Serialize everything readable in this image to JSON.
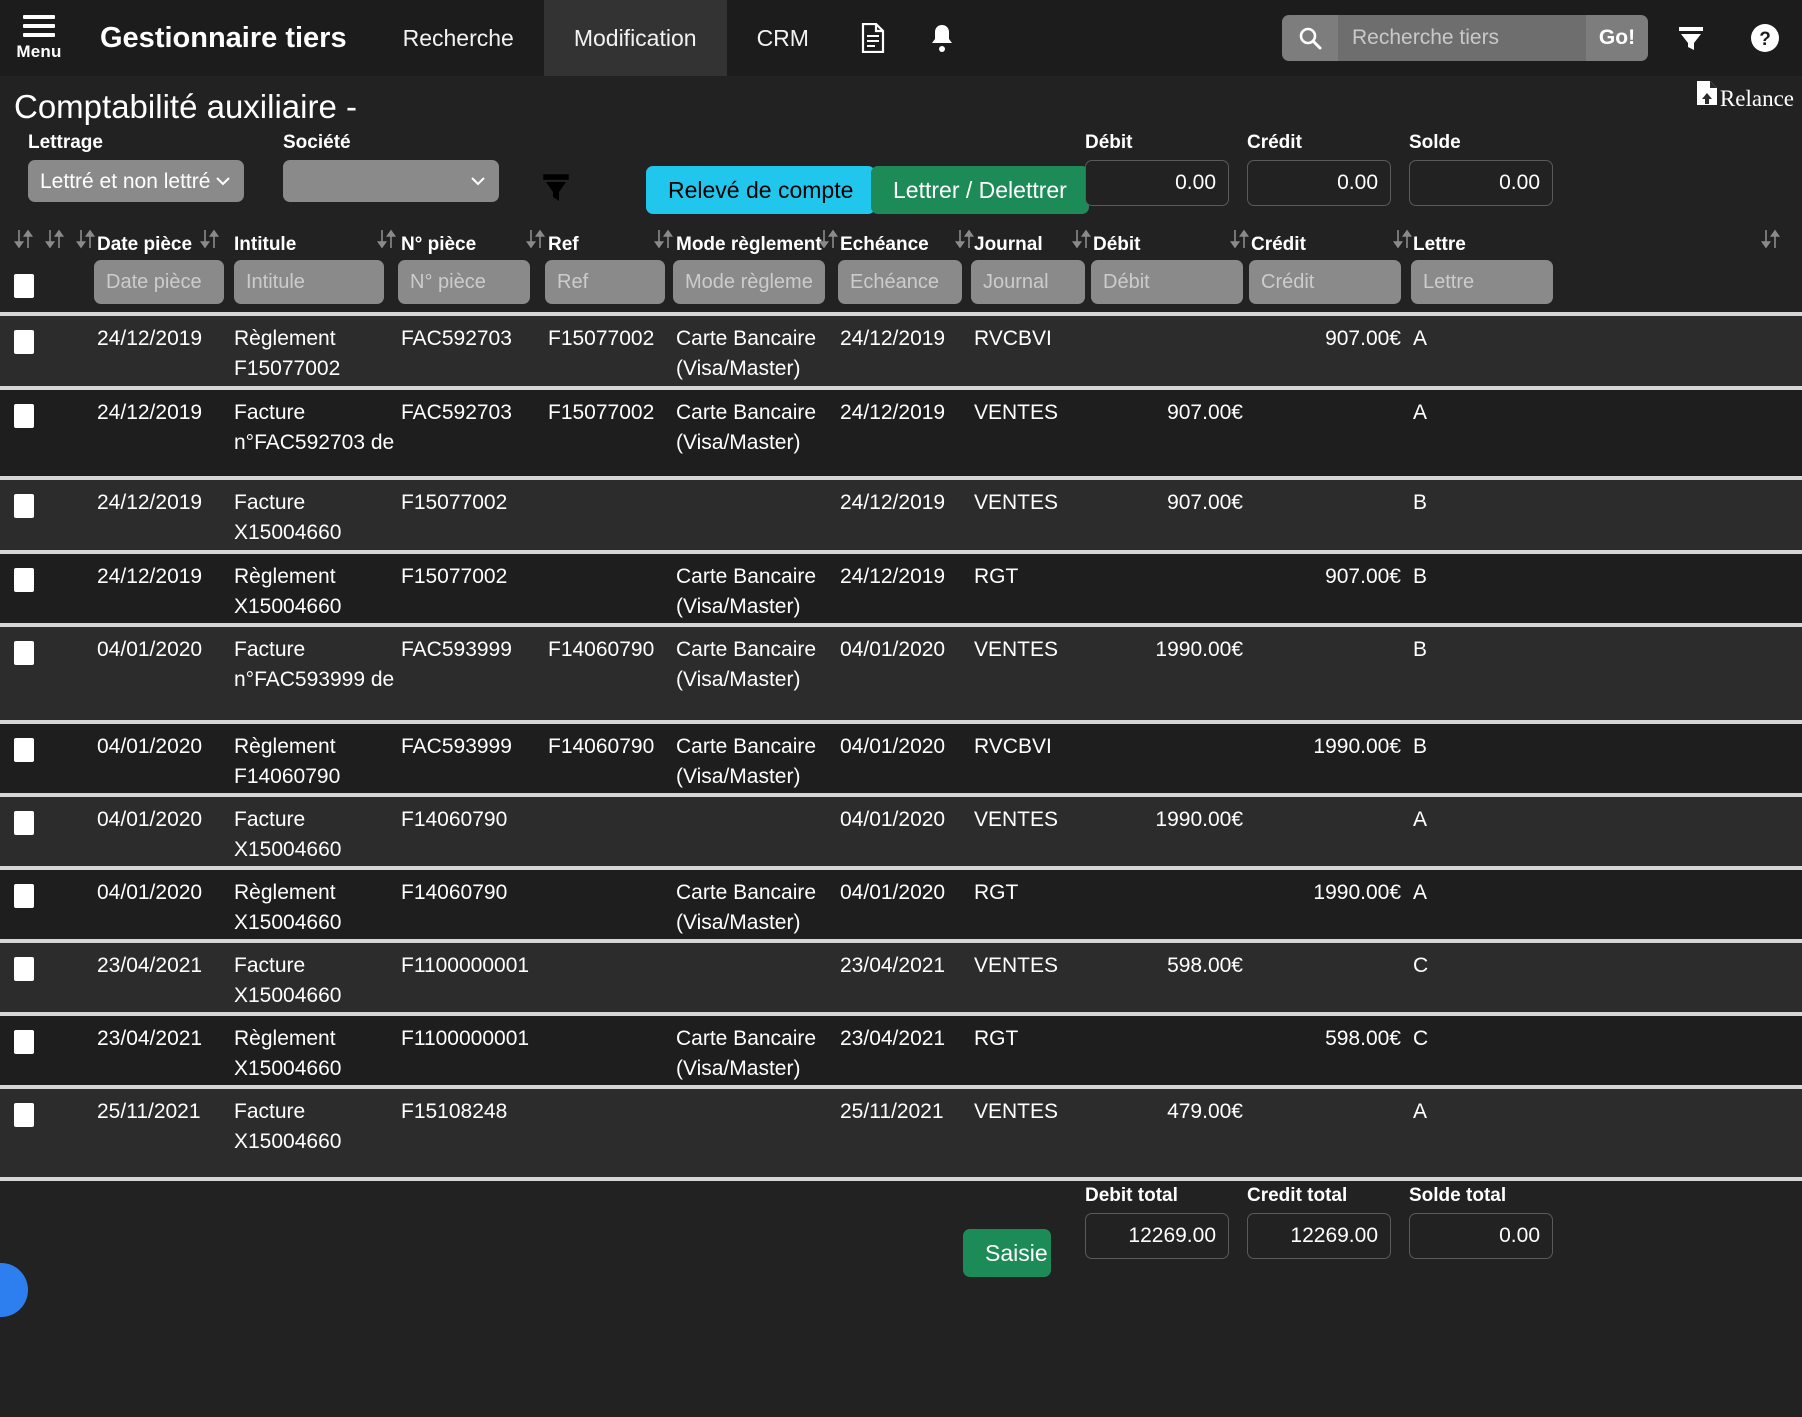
{
  "header": {
    "menu_label": "Menu",
    "app_title": "Gestionnaire tiers",
    "nav": [
      {
        "label": "Recherche",
        "active": false
      },
      {
        "label": "Modification",
        "active": true
      },
      {
        "label": "CRM",
        "active": false
      }
    ],
    "icons": [
      "document-icon",
      "bell-icon"
    ],
    "search": {
      "placeholder": "Recherche tiers",
      "value": "",
      "go_label": "Go!"
    },
    "tools": [
      "filter-icon",
      "help-icon"
    ]
  },
  "page": {
    "title": "Comptabilité auxiliaire -",
    "relance_label": "Relance"
  },
  "filters": {
    "lettrage": {
      "label": "Lettrage",
      "value": "Lettré et non lettré"
    },
    "societe": {
      "label": "Société",
      "value": ""
    },
    "funnel_icon": "funnel-icon",
    "releve_button": "Relevé de compte",
    "lettrer_button": "Lettrer / Delettrer",
    "debit": {
      "label": "Débit",
      "value": "0.00"
    },
    "credit": {
      "label": "Crédit",
      "value": "0.00"
    },
    "solde": {
      "label": "Solde",
      "value": "0.00"
    }
  },
  "table": {
    "columns": [
      {
        "key": "date",
        "label": "Date pièce",
        "placeholder": "Date pièce"
      },
      {
        "key": "intitule",
        "label": "Intitule",
        "placeholder": "Intitule"
      },
      {
        "key": "npiece",
        "label": "N° pièce",
        "placeholder": "N° pièce"
      },
      {
        "key": "ref",
        "label": "Ref",
        "placeholder": "Ref"
      },
      {
        "key": "mode",
        "label": "Mode règlement",
        "placeholder": "Mode règlement"
      },
      {
        "key": "echeance",
        "label": "Echéance",
        "placeholder": "Echéance"
      },
      {
        "key": "journal",
        "label": "Journal",
        "placeholder": "Journal"
      },
      {
        "key": "debit",
        "label": "Débit",
        "placeholder": "Débit"
      },
      {
        "key": "credit",
        "label": "Crédit",
        "placeholder": "Crédit"
      },
      {
        "key": "lettre",
        "label": "Lettre",
        "placeholder": "Lettre"
      }
    ],
    "rows": [
      {
        "date": "24/12/2019",
        "intitule": "Règlement\nF15077002",
        "npiece": "FAC592703",
        "ref": "F15077002",
        "mode": "Carte Bancaire\n(Visa/Master)",
        "echeance": "24/12/2019",
        "journal": "RVCBVI",
        "debit": "",
        "credit": "907.00€",
        "lettre": "A"
      },
      {
        "date": "24/12/2019",
        "intitule": "Facture\nn°FAC592703 de",
        "npiece": "FAC592703",
        "ref": "F15077002",
        "mode": "Carte Bancaire\n(Visa/Master)",
        "echeance": "24/12/2019",
        "journal": "VENTES",
        "debit": "907.00€",
        "credit": "",
        "lettre": "A"
      },
      {
        "date": "24/12/2019",
        "intitule": "Facture\nX15004660",
        "npiece": "F15077002",
        "ref": "",
        "mode": "",
        "echeance": "24/12/2019",
        "journal": "VENTES",
        "debit": "907.00€",
        "credit": "",
        "lettre": "B"
      },
      {
        "date": "24/12/2019",
        "intitule": "Règlement\nX15004660",
        "npiece": "F15077002",
        "ref": "",
        "mode": "Carte Bancaire\n(Visa/Master)",
        "echeance": "24/12/2019",
        "journal": "RGT",
        "debit": "",
        "credit": "907.00€",
        "lettre": "B"
      },
      {
        "date": "04/01/2020",
        "intitule": "Facture\nn°FAC593999 de",
        "npiece": "FAC593999",
        "ref": "F14060790",
        "mode": "Carte Bancaire\n(Visa/Master)",
        "echeance": "04/01/2020",
        "journal": "VENTES",
        "debit": "1990.00€",
        "credit": "",
        "lettre": "B"
      },
      {
        "date": "04/01/2020",
        "intitule": "Règlement\nF14060790",
        "npiece": "FAC593999",
        "ref": "F14060790",
        "mode": "Carte Bancaire\n(Visa/Master)",
        "echeance": "04/01/2020",
        "journal": "RVCBVI",
        "debit": "",
        "credit": "1990.00€",
        "lettre": "B"
      },
      {
        "date": "04/01/2020",
        "intitule": "Facture\nX15004660",
        "npiece": "F14060790",
        "ref": "",
        "mode": "",
        "echeance": "04/01/2020",
        "journal": "VENTES",
        "debit": "1990.00€",
        "credit": "",
        "lettre": "A"
      },
      {
        "date": "04/01/2020",
        "intitule": "Règlement\nX15004660",
        "npiece": "F14060790",
        "ref": "",
        "mode": "Carte Bancaire\n(Visa/Master)",
        "echeance": "04/01/2020",
        "journal": "RGT",
        "debit": "",
        "credit": "1990.00€",
        "lettre": "A"
      },
      {
        "date": "23/04/2021",
        "intitule": "Facture\nX15004660",
        "npiece": "F1100000001",
        "ref": "",
        "mode": "",
        "echeance": "23/04/2021",
        "journal": "VENTES",
        "debit": "598.00€",
        "credit": "",
        "lettre": "C"
      },
      {
        "date": "23/04/2021",
        "intitule": "Règlement\nX15004660",
        "npiece": "F1100000001",
        "ref": "",
        "mode": "Carte Bancaire\n(Visa/Master)",
        "echeance": "23/04/2021",
        "journal": "RGT",
        "debit": "",
        "credit": "598.00€",
        "lettre": "C"
      },
      {
        "date": "25/11/2021",
        "intitule": "Facture\nX15004660",
        "npiece": "F15108248",
        "ref": "",
        "mode": "",
        "echeance": "25/11/2021",
        "journal": "VENTES",
        "debit": "479.00€",
        "credit": "",
        "lettre": "A"
      }
    ]
  },
  "footer": {
    "saisie_button": "Saisie",
    "debit_total": {
      "label": "Debit total",
      "value": "12269.00"
    },
    "credit_total": {
      "label": "Credit total",
      "value": "12269.00"
    },
    "solde_total": {
      "label": "Solde total",
      "value": "0.00"
    }
  },
  "colors": {
    "accent_cyan": "#21c6ec",
    "accent_green": "#1d8b57",
    "fab_blue": "#2d7ff0",
    "background": "#222222",
    "topbar": "#1c1c1c",
    "row_odd": "#2c2c2c",
    "row_even": "#1e1e1e"
  }
}
